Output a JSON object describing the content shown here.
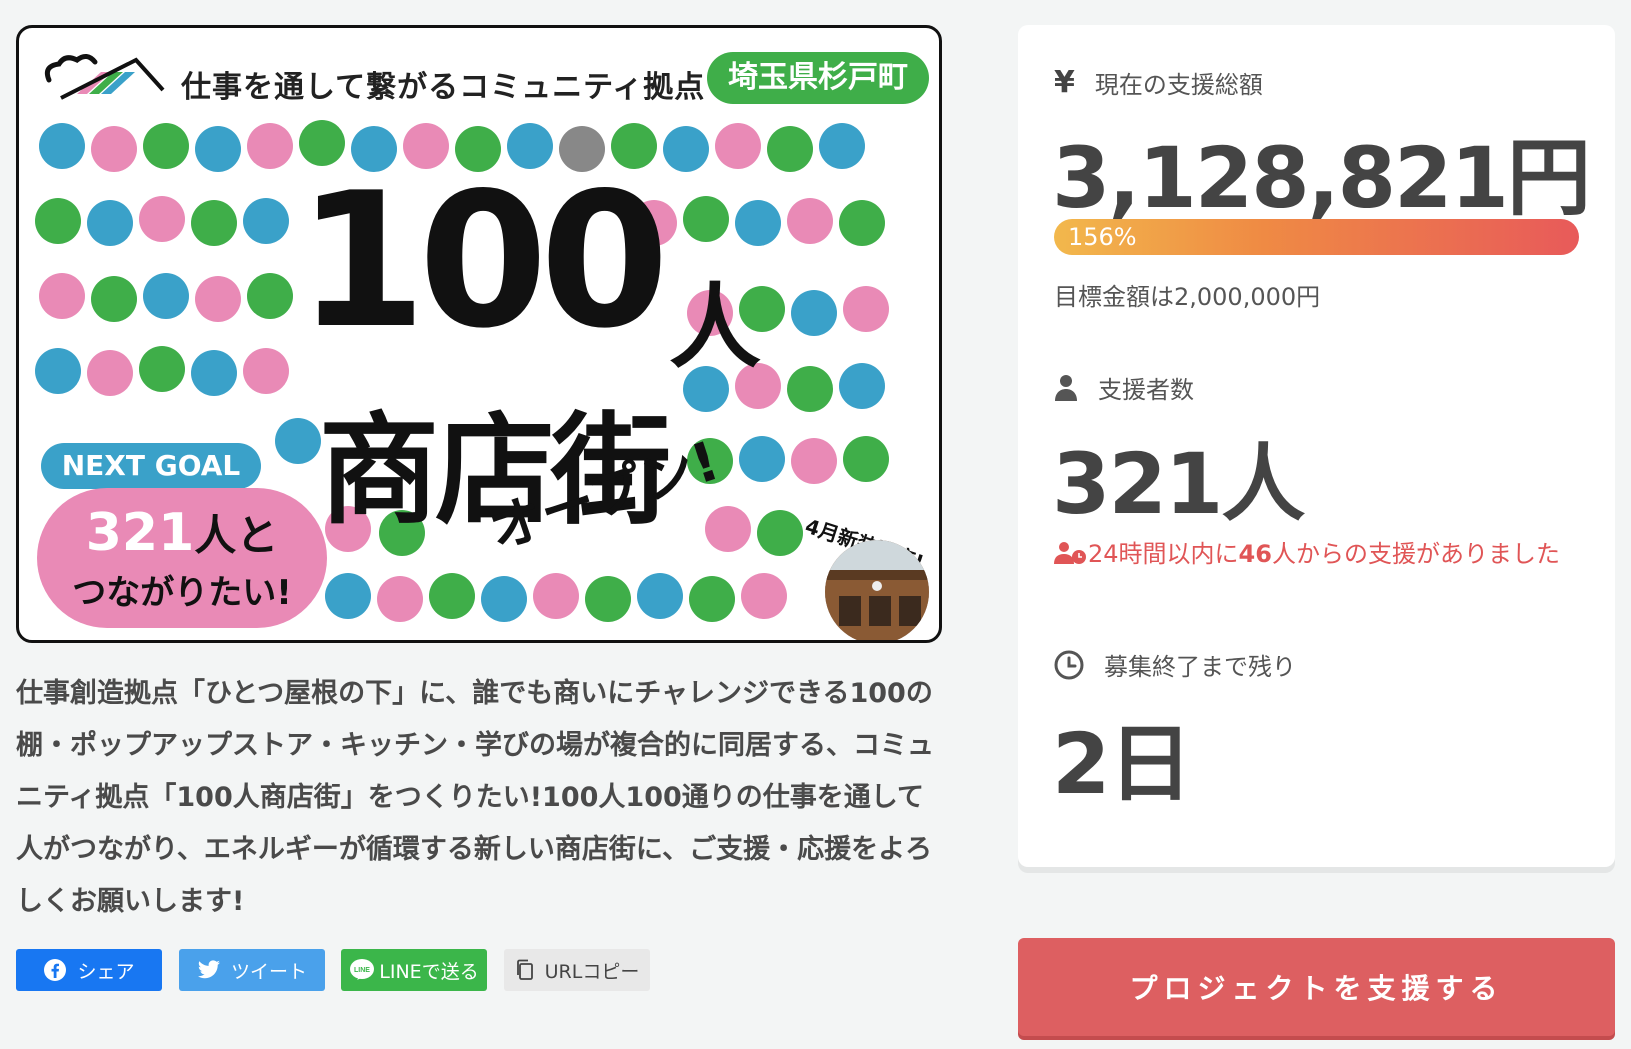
{
  "hero": {
    "headline": "仕事を通して繋がるコミュニティ拠点",
    "pref_badge": "埼玉県杉戸町",
    "big_number": "100",
    "big_nin": "人",
    "big_shop": "商店街",
    "big_open": "オープン!",
    "next_goal_tag": "NEXT GOAL",
    "next_goal_count": "321",
    "next_goal_suffix": "人と",
    "next_goal_line2": "つながりたい!",
    "reopen_label": "4月新装開店!"
  },
  "description": "仕事創造拠点「ひとつ屋根の下」に、誰でも商いにチャレンジできる100の棚・ポップアップストア・キッチン・学びの場が複合的に同居する、コミュニティ拠点「100人商店街」をつくりたい!100人100通りの仕事を通して人がつながり、エネルギーが循環する新しい商店街に、ご支援・応援をよろしくお願いします!",
  "share": {
    "facebook": "シェア",
    "twitter": "ツイート",
    "line": "LINEで送る",
    "url_copy": "URLコピー",
    "colors": {
      "facebook": "#1877f2",
      "twitter": "#4aa1eb",
      "line": "#3bb64a",
      "url_copy": "#e8e8e8"
    }
  },
  "stats": {
    "total_label": "現在の支援総額",
    "total_amount": "3,128,821円",
    "progress_label": "156%",
    "progress_percent": 156,
    "target_text": "目標金額は2,000,000円",
    "supporters_label": "支援者数",
    "supporters_count": "321人",
    "recent_prefix": "24時間以内に",
    "recent_count": "46",
    "recent_suffix": "人からの支援がありました",
    "remaining_label": "募集終了まで残り",
    "remaining_value": "2日",
    "accent_color": "#dd5f61"
  },
  "cta": {
    "support_button": "プロジェクトを支援する"
  },
  "icons": [
    "yen-icon",
    "person-icon",
    "recent-supporters-icon",
    "clock-icon",
    "facebook-icon",
    "twitter-icon",
    "line-icon",
    "copy-icon",
    "community-logo-icon"
  ]
}
